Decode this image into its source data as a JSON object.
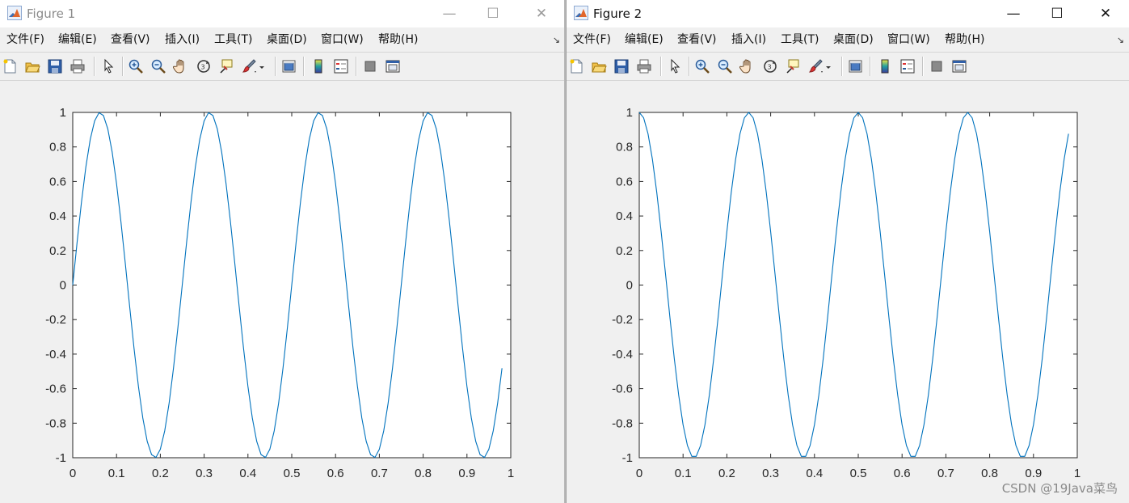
{
  "windows": [
    {
      "title": "Figure 1",
      "active": false,
      "menus": [
        "文件(F)",
        "编辑(E)",
        "查看(V)",
        "插入(I)",
        "工具(T)",
        "桌面(D)",
        "窗口(W)",
        "帮助(H)"
      ],
      "window_controls": [
        "minimize-icon",
        "maximize-icon",
        "close-icon"
      ],
      "toolbar_icons": [
        "new-figure-icon",
        "open-file-icon",
        "save-icon",
        "print-icon",
        "pointer-icon",
        "zoom-in-icon",
        "zoom-out-icon",
        "pan-hand-icon",
        "rotate-3d-icon",
        "data-cursor-icon",
        "brush-icon",
        "link-plot-icon",
        "colorbar-icon",
        "legend-icon",
        "hide-plot-tools-icon",
        "show-plot-tools-icon"
      ]
    },
    {
      "title": "Figure 2",
      "active": true,
      "menus": [
        "文件(F)",
        "编辑(E)",
        "查看(V)",
        "插入(I)",
        "工具(T)",
        "桌面(D)",
        "窗口(W)",
        "帮助(H)"
      ],
      "window_controls": [
        "minimize-icon",
        "maximize-icon",
        "close-icon"
      ],
      "toolbar_icons": [
        "new-figure-icon",
        "open-file-icon",
        "save-icon",
        "print-icon",
        "pointer-icon",
        "zoom-in-icon",
        "zoom-out-icon",
        "pan-hand-icon",
        "rotate-3d-icon",
        "data-cursor-icon",
        "brush-icon",
        "link-plot-icon",
        "colorbar-icon",
        "legend-icon",
        "hide-plot-tools-icon",
        "show-plot-tools-icon"
      ]
    }
  ],
  "watermark": "CSDN @19Java菜鸟",
  "chart_data": [
    {
      "type": "line",
      "function": "sin(2*pi*4*t)",
      "x_start": 0,
      "x_end": 0.98,
      "x_step": 0.01,
      "xlim": [
        0,
        1
      ],
      "ylim": [
        -1,
        1
      ],
      "xticks": [
        "0",
        "0.1",
        "0.2",
        "0.3",
        "0.4",
        "0.5",
        "0.6",
        "0.7",
        "0.8",
        "0.9",
        "1"
      ],
      "yticks": [
        "1",
        "0.8",
        "0.6",
        "0.4",
        "0.2",
        "0",
        "-0.2",
        "-0.4",
        "-0.6",
        "-0.8",
        "-1"
      ],
      "line_color": "#0072bd",
      "grid": false,
      "title": "",
      "xlabel": "",
      "ylabel": ""
    },
    {
      "type": "line",
      "function": "cos(2*pi*4*t)",
      "x_start": 0,
      "x_end": 0.98,
      "x_step": 0.01,
      "xlim": [
        0,
        1
      ],
      "ylim": [
        -1,
        1
      ],
      "xticks": [
        "0",
        "0.1",
        "0.2",
        "0.3",
        "0.4",
        "0.5",
        "0.6",
        "0.7",
        "0.8",
        "0.9",
        "1"
      ],
      "yticks": [
        "1",
        "0.8",
        "0.6",
        "0.4",
        "0.2",
        "0",
        "-0.2",
        "-0.4",
        "-0.6",
        "-0.8",
        "-1"
      ],
      "line_color": "#0072bd",
      "grid": false,
      "title": "",
      "xlabel": "",
      "ylabel": ""
    }
  ]
}
